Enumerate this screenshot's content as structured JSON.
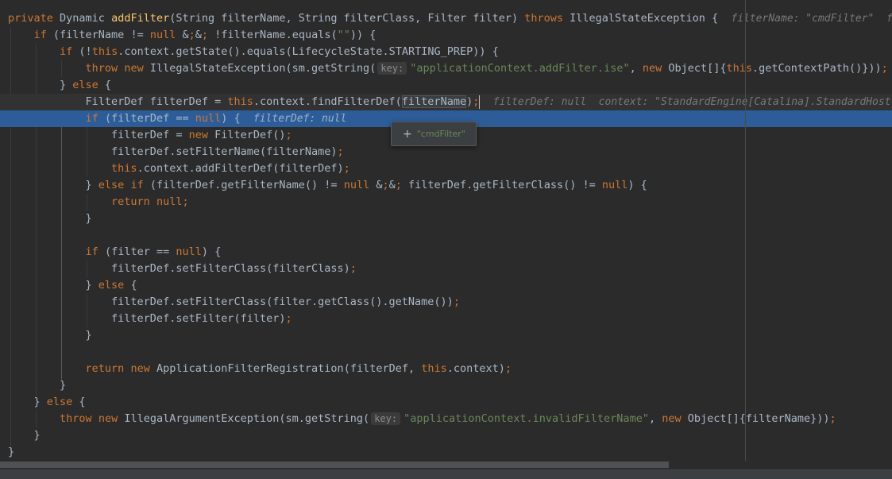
{
  "inline_hints": {
    "method_params": "filterName: \"cmdFilter\"  fi",
    "filterDef_line": "filterDef: null  context: \"StandardEngine[Catalina].StandardHost",
    "if_line": "filterDef: null"
  },
  "param_hints": {
    "key": "key:"
  },
  "tooltip": {
    "icon": "plus-icon",
    "value": "\"cmdFilter\""
  },
  "code": [
    "private Dynamic addFilter(String filterName, String filterClass, Filter filter) throws IllegalStateException {",
    "    if (filterName != null && !filterName.equals(\"\")) {",
    "        if (!this.context.getState().equals(LifecycleState.STARTING_PREP)) {",
    "            throw new IllegalStateException(sm.getString(",
    "\"applicationContext.addFilter.ise\", new Object[]{this.getContextPath()}));",
    "        } else {",
    "            FilterDef filterDef = this.context.findFilterDef(filterName);",
    "            if (filterDef == null) {",
    "                filterDef = new FilterDef();",
    "                filterDef.setFilterName(filterName);",
    "                this.context.addFilterDef(filterDef);",
    "            } else if (filterDef.getFilterName() != null && filterDef.getFilterClass() != null) {",
    "                return null;",
    "            }",
    "            if (filter == null) {",
    "                filterDef.setFilterClass(filterClass);",
    "            } else {",
    "                filterDef.setFilterClass(filter.getClass().getName());",
    "                filterDef.setFilter(filter);",
    "            }",
    "            return new ApplicationFilterRegistration(filterDef, this.context);",
    "        }",
    "    } else {",
    "        throw new IllegalArgumentException(sm.getString(",
    "\"applicationContext.invalidFilterName\", new Object[]{filterName}));",
    "    }",
    "}"
  ]
}
